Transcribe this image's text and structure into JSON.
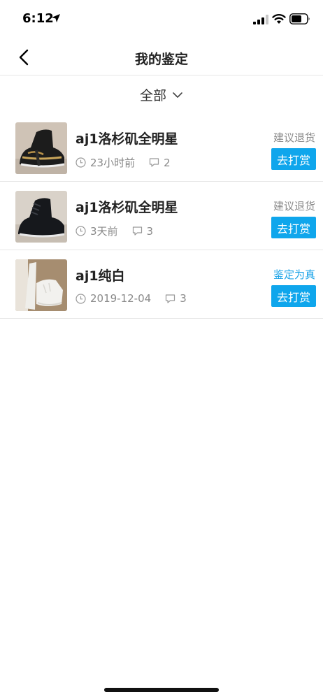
{
  "status_bar": {
    "time": "6:12"
  },
  "nav": {
    "title": "我的鉴定"
  },
  "filter": {
    "label": "全部"
  },
  "items": [
    {
      "title": "aj1洛杉矶全明星",
      "time": "23小时前",
      "comments": "2",
      "verdict": "建议退货",
      "verdict_color": "#8a8a8a",
      "button_label": "去打赏",
      "image": "black-gold-high-top-sneaker"
    },
    {
      "title": "aj1洛杉矶全明星",
      "time": "3天前",
      "comments": "3",
      "verdict": "建议退货",
      "verdict_color": "#8a8a8a",
      "button_label": "去打赏",
      "image": "black-high-top-sneaker"
    },
    {
      "title": "aj1纯白",
      "time": "2019-12-04",
      "comments": "3",
      "verdict": "鉴定为真",
      "verdict_color": "#1aa3e8",
      "button_label": "去打赏",
      "image": "white-sneaker"
    }
  ],
  "colors": {
    "accent": "#0fa6ec",
    "divider": "#e6e6e6",
    "meta_text": "#8a8a8a"
  }
}
